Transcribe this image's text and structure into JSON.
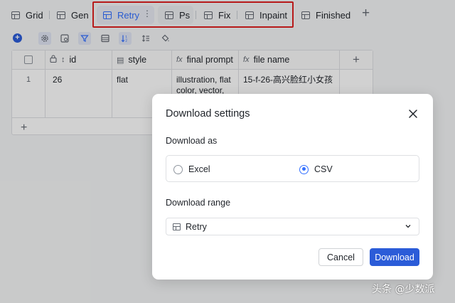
{
  "tabs": [
    {
      "label": "Grid"
    },
    {
      "label": "Gen"
    },
    {
      "label": "Retry"
    },
    {
      "label": "Ps"
    },
    {
      "label": "Fix"
    },
    {
      "label": "Inpaint"
    },
    {
      "label": "Finished"
    }
  ],
  "tab_menu_glyph": "⋮",
  "add_tab_glyph": "+",
  "toolbar": {
    "add_glyph": "+",
    "icons": [
      "add-record-icon",
      "settings-icon",
      "field-icon",
      "filter-icon",
      "group-icon",
      "sort-icon",
      "row-height-icon",
      "fill-color-icon"
    ]
  },
  "grid": {
    "columns": [
      {
        "label": "id"
      },
      {
        "label": "style"
      },
      {
        "label": "final prompt"
      },
      {
        "label": "file name"
      }
    ],
    "column_type_glyphs": {
      "style": "▤",
      "formula": "fx",
      "id": "↕"
    },
    "add_column_glyph": "+",
    "add_row_glyph": "+",
    "rows": [
      {
        "row_number": "1",
        "id": "26",
        "style": "flat",
        "final_prompt": "illustration, flat color, vector,",
        "file_name": "15-f-26-高兴脸红小女孩"
      }
    ]
  },
  "modal": {
    "title": "Download settings",
    "close_glyph": "✕",
    "download_as_label": "Download as",
    "options": [
      {
        "label": "Excel",
        "selected": false
      },
      {
        "label": "CSV",
        "selected": true
      }
    ],
    "range_label": "Download range",
    "range_value": "Retry",
    "cancel_label": "Cancel",
    "download_label": "Download"
  },
  "colors": {
    "accent": "#3370ff",
    "primary_button": "#2b5cd8",
    "highlight_box": "#e02020"
  },
  "watermark": "头条 @少数派"
}
